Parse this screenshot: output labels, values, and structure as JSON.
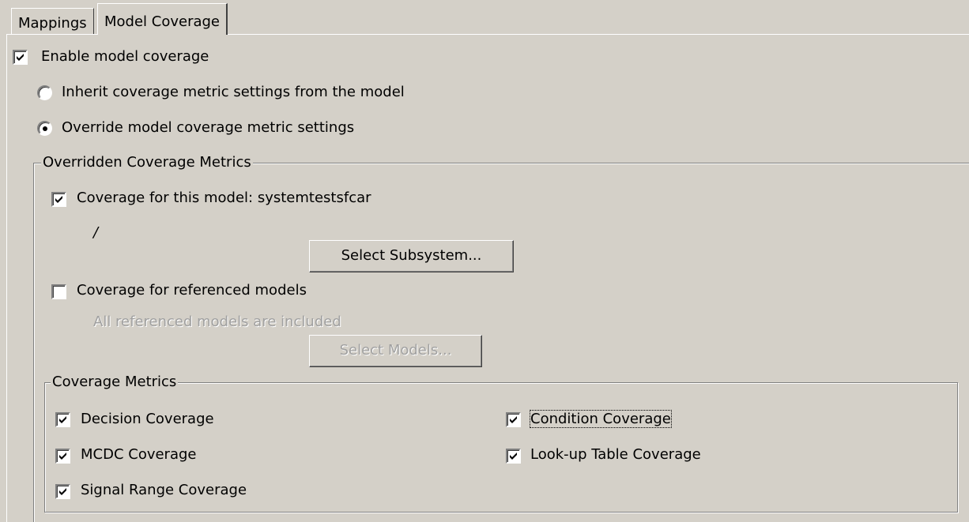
{
  "tabs": [
    {
      "label": "Mappings",
      "active": false
    },
    {
      "label": "Model Coverage",
      "active": true
    }
  ],
  "enable_coverage": {
    "label": "Enable model coverage",
    "checked": true
  },
  "radio_inherit": {
    "label": "Inherit coverage metric settings from the model",
    "selected": false
  },
  "radio_override": {
    "label": "Override model coverage metric settings",
    "selected": true
  },
  "overridden_group": {
    "title": "Overridden Coverage Metrics",
    "this_model": {
      "label": "Coverage for this model: systemtestsfcar",
      "checked": true
    },
    "subsystem_path": "/",
    "select_subsystem_button": "Select Subsystem...",
    "referenced_models": {
      "label": "Coverage for referenced models",
      "checked": false
    },
    "referenced_note": "All referenced models are included",
    "select_models_button": "Select Models..."
  },
  "metrics_group": {
    "title": "Coverage Metrics",
    "items": [
      {
        "label": "Decision Coverage",
        "checked": true
      },
      {
        "label": "Condition Coverage",
        "checked": true
      },
      {
        "label": "MCDC Coverage",
        "checked": true
      },
      {
        "label": "Look-up Table Coverage",
        "checked": true
      },
      {
        "label": "Signal Range Coverage",
        "checked": true
      }
    ]
  },
  "colors": {
    "face": "#d4d0c8",
    "shadow": "#808080",
    "highlight": "#ffffff",
    "disabled_text": "#a0a0a0"
  },
  "icons": {
    "check": "check-mark-icon",
    "radio": "radio-dot-icon"
  }
}
